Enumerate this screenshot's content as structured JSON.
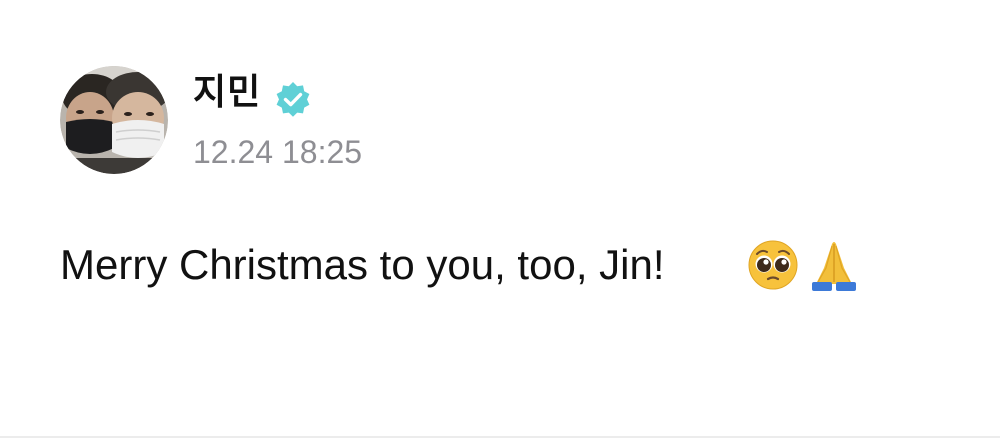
{
  "post": {
    "author_name": "지민",
    "verified": true,
    "timestamp": "12.24 18:25",
    "message_text": "Merry Christmas to you, too, Jin!",
    "emojis": [
      "pleading-face",
      "folded-hands"
    ]
  },
  "colors": {
    "verified_badge": "#5fd0d6",
    "timestamp": "#8e8e93",
    "text": "#111111",
    "background": "#ffffff"
  }
}
